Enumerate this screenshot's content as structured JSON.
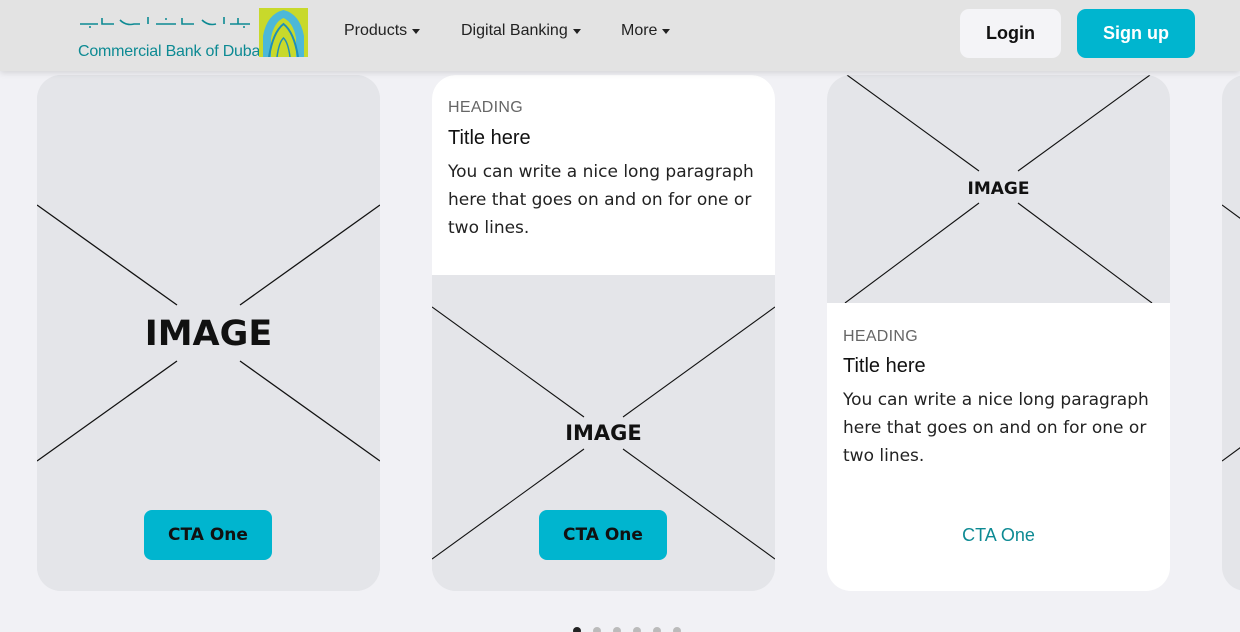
{
  "brand": {
    "name_en": "Commercial Bank of Dubai",
    "name_ar": "بنك دبي التجاري",
    "colors": {
      "teal": "#0d8a93",
      "accent": "#00b5cf",
      "lime": "#c8d92b"
    }
  },
  "nav": {
    "items": [
      {
        "label": "Products"
      },
      {
        "label": "Digital Banking"
      },
      {
        "label": "More"
      }
    ],
    "login_label": "Login",
    "signup_label": "Sign up"
  },
  "cards": [
    {
      "image_label": "IMAGE",
      "cta": "CTA One"
    },
    {
      "heading": "HEADING",
      "title": "Title here",
      "paragraph": "You can write a nice long paragraph here that goes on and on for one or two lines.",
      "image_label": "IMAGE",
      "cta": "CTA One"
    },
    {
      "image_label": "IMAGE",
      "heading": "HEADING",
      "title": "Title here",
      "paragraph": "You can write a nice long paragraph here that goes on and on for one or two lines.",
      "cta": "CTA One"
    }
  ],
  "pagination": {
    "count": 6,
    "active": 0
  }
}
